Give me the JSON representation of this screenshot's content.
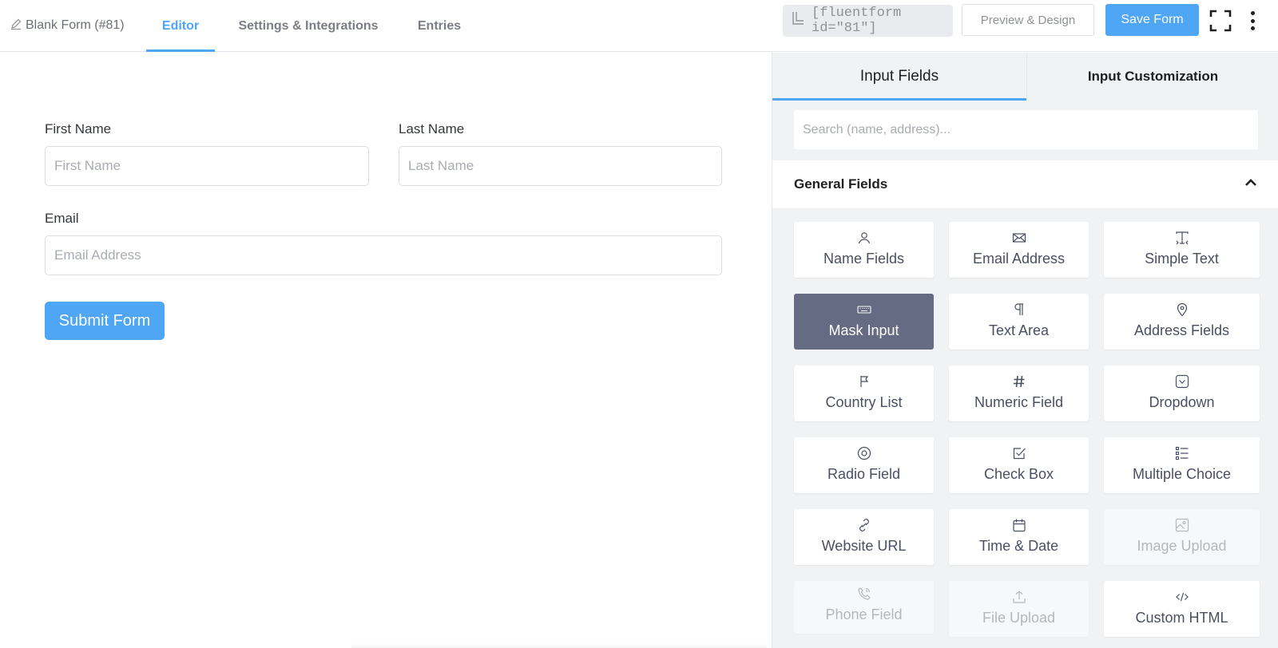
{
  "header": {
    "form_title": "Blank Form (#81)",
    "tabs": [
      {
        "label": "Editor",
        "active": true
      },
      {
        "label": "Settings & Integrations",
        "active": false
      },
      {
        "label": "Entries",
        "active": false
      }
    ],
    "shortcode": "[fluentform id=\"81\"]",
    "preview_label": "Preview & Design",
    "save_label": "Save Form"
  },
  "form": {
    "first_name": {
      "label": "First Name",
      "placeholder": "First Name"
    },
    "last_name": {
      "label": "Last Name",
      "placeholder": "Last Name"
    },
    "email": {
      "label": "Email",
      "placeholder": "Email Address"
    },
    "submit_label": "Submit Form"
  },
  "sidebar": {
    "tabs": [
      {
        "label": "Input Fields",
        "active": true
      },
      {
        "label": "Input Customization",
        "active": false
      }
    ],
    "search_placeholder": "Search (name, address)...",
    "group_title": "General Fields",
    "fields": [
      {
        "label": "Name Fields",
        "icon": "user-icon"
      },
      {
        "label": "Email Address",
        "icon": "envelope-icon"
      },
      {
        "label": "Simple Text",
        "icon": "text-cursor-icon"
      },
      {
        "label": "Mask Input",
        "icon": "keyboard-icon",
        "state": "active"
      },
      {
        "label": "Text Area",
        "icon": "paragraph-icon"
      },
      {
        "label": "Address Fields",
        "icon": "map-pin-icon"
      },
      {
        "label": "Country List",
        "icon": "flag-icon"
      },
      {
        "label": "Numeric Field",
        "icon": "hash-icon"
      },
      {
        "label": "Dropdown",
        "icon": "dropdown-icon"
      },
      {
        "label": "Radio Field",
        "icon": "radio-icon"
      },
      {
        "label": "Check Box",
        "icon": "checkbox-icon"
      },
      {
        "label": "Multiple Choice",
        "icon": "list-icon"
      },
      {
        "label": "Website URL",
        "icon": "link-icon"
      },
      {
        "label": "Time & Date",
        "icon": "calendar-icon"
      },
      {
        "label": "Image Upload",
        "icon": "image-icon",
        "state": "disabled"
      },
      {
        "label": "Phone Field",
        "icon": "phone-icon",
        "state": "disabled"
      },
      {
        "label": "File Upload",
        "icon": "upload-icon",
        "state": "disabled"
      },
      {
        "label": "Custom HTML",
        "icon": "code-icon"
      }
    ]
  },
  "colors": {
    "accent": "#4ea6f5",
    "active_card": "#646b83",
    "sidebar_bg": "#f1f2f4"
  }
}
